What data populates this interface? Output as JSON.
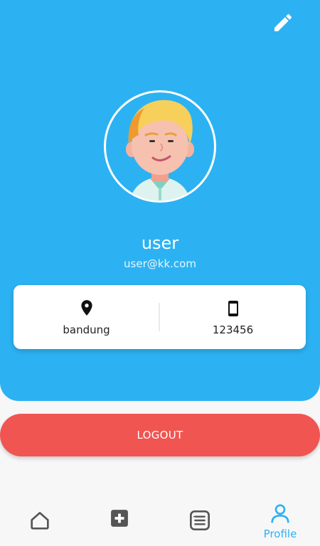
{
  "header": {
    "edit_icon": "pencil-icon",
    "avatar": "user-avatar-illustration",
    "username": "user",
    "email": "user@kk.com",
    "background_color": "#2cb2f3"
  },
  "info": {
    "location": {
      "icon": "location-pin-icon",
      "value": "bandung"
    },
    "phone": {
      "icon": "smartphone-icon",
      "value": "123456"
    }
  },
  "logout_label": "LOGOUT",
  "logout_color": "#f05551",
  "nav": {
    "items": [
      {
        "icon": "home-icon",
        "label": ""
      },
      {
        "icon": "medical-plus-icon",
        "label": ""
      },
      {
        "icon": "list-icon",
        "label": ""
      },
      {
        "icon": "profile-icon",
        "label": "Profile",
        "active": true
      }
    ],
    "active_color": "#2cb2f3"
  }
}
